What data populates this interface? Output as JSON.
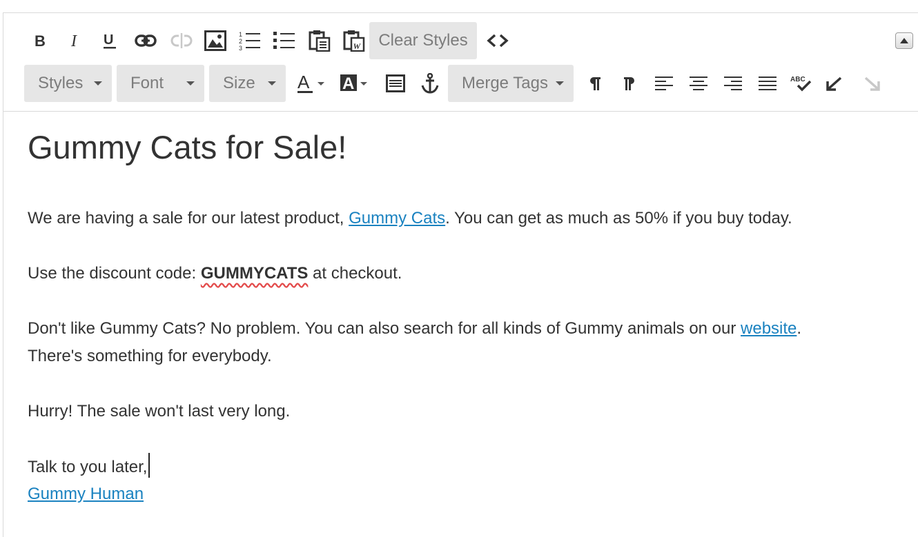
{
  "toolbar": {
    "clear_styles_label": "Clear Styles",
    "styles_label": "Styles",
    "font_label": "Font",
    "size_label": "Size",
    "merge_tags_label": "Merge Tags",
    "spellcheck_glyph": "ABC",
    "icons": [
      "bold-icon",
      "italic-icon",
      "underline-icon",
      "link-icon",
      "unlink-icon",
      "image-icon",
      "numbered-list-icon",
      "bulleted-list-icon",
      "paste-icon",
      "paste-from-word-icon",
      "source-code-icon",
      "text-color-icon",
      "background-color-icon",
      "horizontal-rule-icon",
      "anchor-icon",
      "ltr-icon",
      "rtl-icon",
      "align-left-icon",
      "align-center-icon",
      "align-right-icon",
      "justify-icon",
      "spellcheck-icon",
      "undo-icon",
      "redo-icon",
      "collapse-toolbar-icon"
    ],
    "colors": {
      "button_bg": "#e6e6e6",
      "label_gray": "#7c7c7c",
      "link_blue": "#1a82c0",
      "disabled_gray": "#c8c8c8"
    }
  },
  "document": {
    "heading": "Gummy Cats for Sale!",
    "p1_before": "We are having a sale for our latest product, ",
    "p1_link": "Gummy Cats",
    "p1_after": ". You can get as much as 50% if you buy today.",
    "p2_before": "Use the discount code: ",
    "p2_code": "GUMMYCATS",
    "p2_after": " at checkout.",
    "p3_before": "Don't like Gummy Cats? No problem. You can also search for all kinds of Gummy animals on our ",
    "p3_link": "website",
    "p3_after": ".",
    "p3_line2": "There's something for everybody.",
    "p4": "Hurry! The sale won't last very long.",
    "p5": "Talk to you later,",
    "signature_link": "Gummy Human"
  }
}
